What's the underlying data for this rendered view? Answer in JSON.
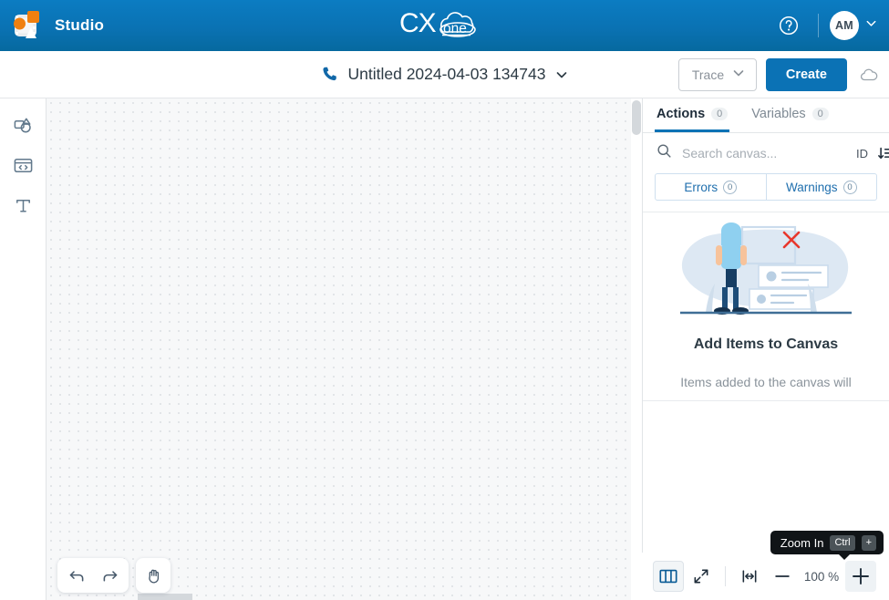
{
  "header": {
    "app_name": "Studio",
    "app_icon": "studio-logo-icon",
    "brand_logo": "cxone-logo",
    "brand_text_primary": "CX",
    "brand_text_secondary": "one",
    "help_icon": "help-circle-icon",
    "avatar_initials": "AM",
    "avatar_caret_icon": "chevron-down-icon",
    "bg_color": "#0b7cc2"
  },
  "toolbar": {
    "phone_icon": "phone-icon",
    "script_title": "Untitled 2024-04-03 134743",
    "title_caret_icon": "chevron-down-icon",
    "trace_label": "Trace",
    "trace_caret_icon": "chevron-down-icon",
    "create_label": "Create",
    "cloud_icon": "cloud-icon",
    "create_color": "#0b72b5"
  },
  "left_rail": {
    "items": [
      {
        "name": "shapes-icon",
        "label": "Actions"
      },
      {
        "name": "code-window-icon",
        "label": "Snippet"
      },
      {
        "name": "text-t-icon",
        "label": "Text"
      }
    ]
  },
  "canvas": {
    "grid": "dot-grid",
    "bg_color": "#f7f8f9",
    "dot_color": "#e2e5e8"
  },
  "canvas_tools": {
    "undo_icon": "undo-arrow-icon",
    "redo_icon": "redo-arrow-icon",
    "pan_icon": "hand-pan-icon"
  },
  "right_panel": {
    "tabs": [
      {
        "label": "Actions",
        "count": "0",
        "active": true
      },
      {
        "label": "Variables",
        "count": "0",
        "active": false
      }
    ],
    "search": {
      "icon": "search-icon",
      "placeholder": "Search canvas...",
      "value": "",
      "id_label": "ID",
      "sort_icon": "sort-descending-icon"
    },
    "segments": [
      {
        "label": "Errors",
        "count": "0"
      },
      {
        "label": "Warnings",
        "count": "0"
      }
    ],
    "empty_state": {
      "illustration": "person-empty-canvas-illustration",
      "title": "Add Items to Canvas",
      "subtitle": "Items added to the canvas will"
    }
  },
  "zoom_bar": {
    "minimap_icon": "minimap-book-icon",
    "expand_icon": "expand-diagonal-icon",
    "fit_width_icon": "fit-width-icon",
    "zoom_out_icon": "minus-icon",
    "zoom_level": "100 %",
    "zoom_in_icon": "plus-icon",
    "tooltip": {
      "text": "Zoom In",
      "key_modifier": "Ctrl",
      "key_main": "+"
    }
  }
}
